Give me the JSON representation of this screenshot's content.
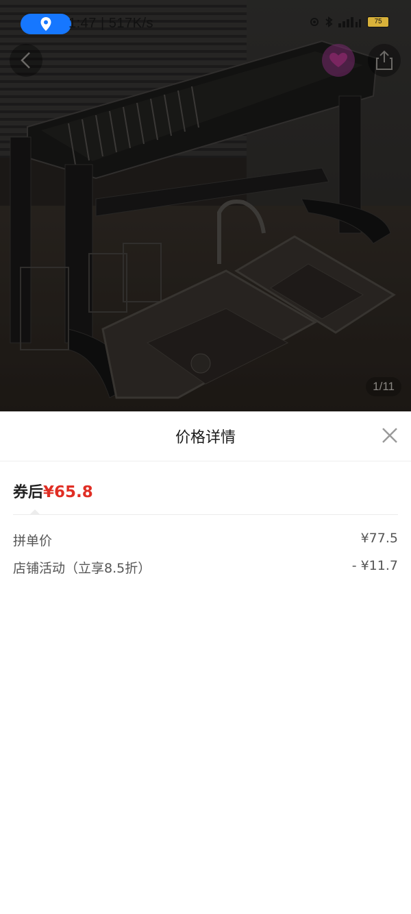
{
  "status_bar": {
    "time": "1:47",
    "net_speed": "517K/s",
    "battery": "75"
  },
  "image_viewer": {
    "counter": "1/11"
  },
  "sheet": {
    "title": "价格详情",
    "after_coupon": {
      "label": "券后",
      "amount": "¥65.8"
    },
    "rows": [
      {
        "label": "拼单价",
        "value": "¥77.5"
      },
      {
        "label": "店铺活动（立享8.5折）",
        "value": "- ¥11.7"
      }
    ]
  },
  "colors": {
    "accent": "#e02e24",
    "location_pill": "#1677ff"
  },
  "icons": {
    "location": "location-pin-icon",
    "back": "back-arrow-icon",
    "share": "share-icon",
    "close": "close-icon"
  }
}
